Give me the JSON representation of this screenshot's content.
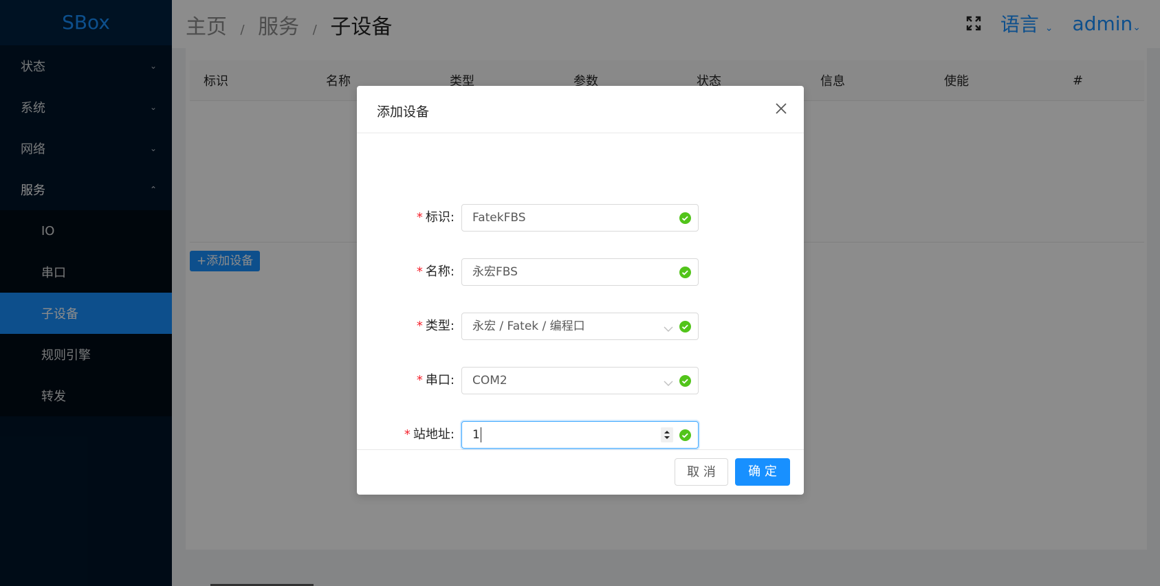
{
  "app": {
    "logo": "SBox"
  },
  "sidebar": {
    "items": [
      {
        "label": "状态",
        "expanded": false
      },
      {
        "label": "系统",
        "expanded": false
      },
      {
        "label": "网络",
        "expanded": false
      },
      {
        "label": "服务",
        "expanded": true
      }
    ],
    "subitems": [
      {
        "label": "IO"
      },
      {
        "label": "串口"
      },
      {
        "label": "子设备",
        "active": true
      },
      {
        "label": "规则引擎"
      },
      {
        "label": "转发"
      }
    ]
  },
  "header": {
    "breadcrumb": [
      "主页",
      "服务",
      "子设备"
    ],
    "separator": "/",
    "language": "语言",
    "user": "admin"
  },
  "table": {
    "columns": [
      "标识",
      "名称",
      "类型",
      "参数",
      "状态",
      "信息",
      "使能",
      "#"
    ]
  },
  "toolbar": {
    "add_label": "+添加设备"
  },
  "modal": {
    "title": "添加设备",
    "fields": [
      {
        "label": "标识:",
        "value": "FatekFBS",
        "type": "text"
      },
      {
        "label": "名称:",
        "value": "永宏FBS",
        "type": "text"
      },
      {
        "label": "类型:",
        "value": "永宏 / Fatek / 编程口",
        "type": "cascader"
      },
      {
        "label": "串口:",
        "value": "COM2",
        "type": "select"
      },
      {
        "label": "站地址:",
        "value": "1",
        "type": "number"
      }
    ],
    "cancel_label": "取 消",
    "ok_label": "确 定"
  },
  "colors": {
    "primary": "#1890ff",
    "sidebar": "#001529",
    "success": "#52c41a",
    "required": "#f5222d"
  }
}
